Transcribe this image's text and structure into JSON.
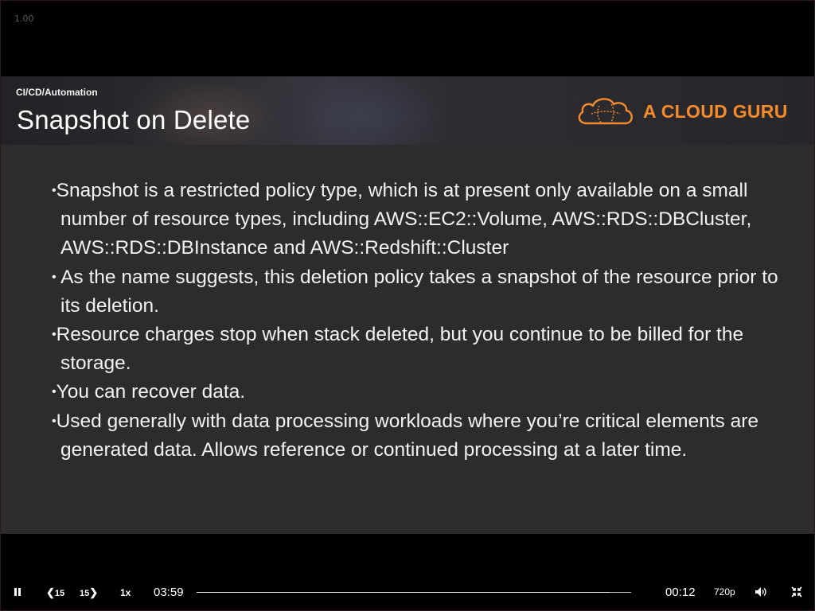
{
  "overlay": {
    "playback_rate": "1.00"
  },
  "slide": {
    "breadcrumb": "CI/CD/Automation",
    "title": "Snapshot on Delete",
    "logo_text": "A CLOUD GURU",
    "bullets": [
      "Snapshot is a restricted policy type, which is at present only available on a small number of resource types, including AWS::EC2::Volume, AWS::RDS::DBCluster, AWS::RDS::DBInstance and AWS::Redshift::Cluster",
      " As the name suggests, this deletion policy takes a snapshot of the resource prior to its deletion.",
      "Resource charges stop when stack deleted, but you continue to be billed for the storage.",
      "You can recover data.",
      "Used generally with data processing workloads where you’re critical elements are generated data. Allows reference or continued processing at a later time."
    ],
    "colors": {
      "accent": "#f58b2b",
      "background": "#2c2b2e"
    }
  },
  "player": {
    "skip_back_label": "15",
    "skip_forward_label": "15",
    "speed_label": "1x",
    "current_time": "03:59",
    "remaining_time": "00:12",
    "quality_label": "720p",
    "progress_fraction": 0.95
  },
  "icons": {
    "play_pause": "pause-icon",
    "skip_back": "rewind-15-icon",
    "skip_forward": "forward-15-icon",
    "volume": "volume-icon",
    "fullscreen": "exit-fullscreen-icon",
    "logo": "cloud-logo-icon"
  }
}
